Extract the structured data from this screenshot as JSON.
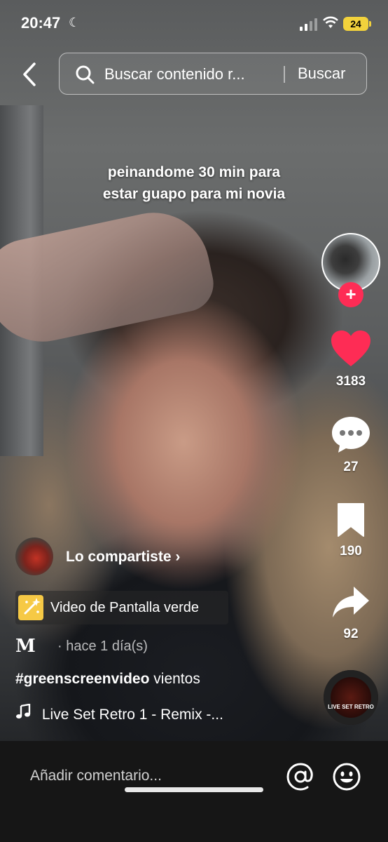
{
  "status_bar": {
    "time": "20:47",
    "battery": "24",
    "icons": [
      "moon-icon",
      "signal-icon",
      "wifi-icon",
      "battery-icon"
    ]
  },
  "search": {
    "placeholder": "Buscar contenido r...",
    "button_label": "Buscar"
  },
  "video": {
    "caption_line1": "peinandome 30 min para",
    "caption_line2": "estar guapo para mi novia"
  },
  "right_rail": {
    "likes": "3183",
    "comments": "27",
    "saves": "190",
    "shares": "92",
    "like_color": "#fe2c55",
    "follow_color": "#fe2c55"
  },
  "music_disc": {
    "cover_text": "LIVE SET RETRO"
  },
  "post": {
    "shared_label": "Lo compartiste",
    "effect_label": "Video de Pantalla verde",
    "username_glyph": "M",
    "date": "· hace 1 día(s)",
    "hashtag": "#greenscreenvideo",
    "hashtag_text": "vientos",
    "sound": "Live Set Retro 1 - Remix -..."
  },
  "comment_bar": {
    "placeholder": "Añadir comentario..."
  }
}
